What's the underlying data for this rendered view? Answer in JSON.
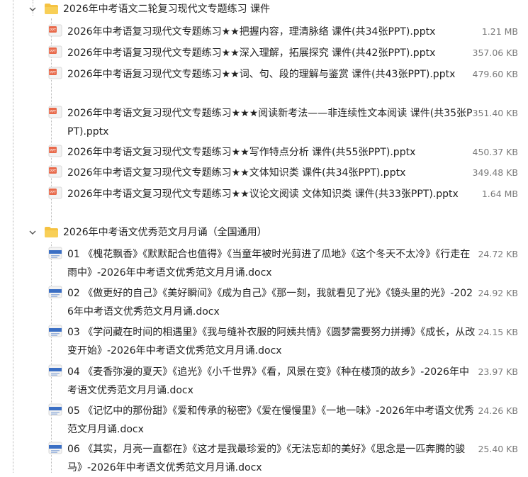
{
  "folders": [
    {
      "name": "2026年中考语文二轮复习现代文专题练习 课件",
      "icon": "folder-icon",
      "files": [
        {
          "name": "2026年中考语复习现代文专题练习★★把握内容，理清脉络 课件(共34张PPT).pptx",
          "size": "1.21 MB",
          "icon": "pptx-file-icon"
        },
        {
          "name": "2026年中考语复习现代文专题练习★★深入理解，拓展探究 课件(共42张PPT).pptx",
          "size": "357.06 KB",
          "icon": "pptx-file-icon"
        },
        {
          "name": "2026年中考语复习现代文专题练习★★词、句、段的理解与鉴赏 课件(共43张PPT).pptx",
          "size": "479.60 KB",
          "icon": "pptx-file-icon"
        },
        {
          "name": "2026年中考语文复习现代文专题练习★★★阅读新考法——非连续性文本阅读 课件(共35张PPT).pptx",
          "size": "351.40 KB",
          "icon": "pptx-file-icon"
        },
        {
          "name": "2026年中考语文复习现代文专题练习★★写作特点分析 课件(共55张PPT).pptx",
          "size": "450.37 KB",
          "icon": "pptx-file-icon"
        },
        {
          "name": "2026年中考语文复习现代文专题练习★★文体知识类 课件(共34张PPT).pptx",
          "size": "349.48 KB",
          "icon": "pptx-file-icon"
        },
        {
          "name": "2026年中考语文复习现代文专题练习★★议论文阅读 文体知识类 课件(共33张PPT).pptx",
          "size": "1.64 MB",
          "icon": "pptx-file-icon"
        }
      ]
    },
    {
      "name": "2026年中考语文优秀范文月月诵（全国通用）",
      "icon": "folder-icon",
      "files": [
        {
          "name": "01 《槐花飘香》《默默配合也值得》《当童年被时光剪进了瓜地》《这个冬天不太冷》《行走在雨中》-2026年中考语文优秀范文月月诵.docx",
          "size": "24.72 KB",
          "icon": "docx-file-icon"
        },
        {
          "name": "02 《做更好的自己》《美好瞬间》《成为自己》《那一刻，我就看见了光》《镜头里的光》-2026年中考语文优秀范文月月诵.docx",
          "size": "24.92 KB",
          "icon": "docx-file-icon"
        },
        {
          "name": "03 《学问藏在时间的相遇里》《我与缝补衣服的阿姨共情》《圆梦需要努力拼搏》《成长，从改变开始》-2026年中考语文优秀范文月月诵.docx",
          "size": "24.15 KB",
          "icon": "docx-file-icon"
        },
        {
          "name": "04 《麦香弥漫的夏天》《追光》《小千世界》《看，风景在变》《种在楼顶的故乡》-2026年中考语文优秀范文月月诵.docx",
          "size": "23.97 KB",
          "icon": "docx-file-icon"
        },
        {
          "name": "05 《记忆中的那份甜》《爱和传承的秘密》《爱在慢慢里》《一地一味》-2026年中考语文优秀范文月月诵.docx",
          "size": "24.26 KB",
          "icon": "docx-file-icon"
        },
        {
          "name": "06 《其实，月亮一直都在》《这才是我最珍爱的》《无法忘却的美好》《思念是一匹奔腾的骏马》-2026年中考语文优秀范文月月诵.docx",
          "size": "25.40 KB",
          "icon": "docx-file-icon"
        }
      ]
    }
  ]
}
